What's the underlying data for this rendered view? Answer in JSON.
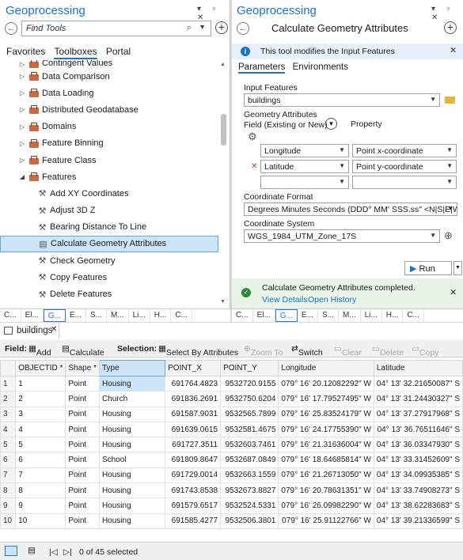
{
  "left": {
    "title": "Geoprocessing",
    "search_placeholder": "Find Tools",
    "tabs": [
      "Favorites",
      "Toolboxes",
      "Portal"
    ],
    "tree": [
      {
        "label": "Contingent Values",
        "level": 1,
        "type": "toolbox",
        "partial": true
      },
      {
        "label": "Data Comparison",
        "level": 1,
        "type": "toolbox"
      },
      {
        "label": "Data Loading",
        "level": 1,
        "type": "toolbox"
      },
      {
        "label": "Distributed Geodatabase",
        "level": 1,
        "type": "toolbox"
      },
      {
        "label": "Domains",
        "level": 1,
        "type": "toolbox"
      },
      {
        "label": "Feature Binning",
        "level": 1,
        "type": "toolbox"
      },
      {
        "label": "Feature Class",
        "level": 1,
        "type": "toolbox"
      },
      {
        "label": "Features",
        "level": 1,
        "type": "toolbox",
        "expanded": true
      },
      {
        "label": "Add XY Coordinates",
        "level": 2,
        "type": "tool"
      },
      {
        "label": "Adjust 3D Z",
        "level": 2,
        "type": "tool"
      },
      {
        "label": "Bearing Distance To Line",
        "level": 2,
        "type": "tool"
      },
      {
        "label": "Calculate Geometry Attributes",
        "level": 2,
        "type": "script",
        "selected": true
      },
      {
        "label": "Check Geometry",
        "level": 2,
        "type": "tool"
      },
      {
        "label": "Copy Features",
        "level": 2,
        "type": "tool"
      },
      {
        "label": "Delete Features",
        "level": 2,
        "type": "tool"
      }
    ],
    "bottom_tabs": [
      "C...",
      "El...",
      "G...",
      "E...",
      "S...",
      "M...",
      "Li...",
      "H...",
      "C..."
    ]
  },
  "right": {
    "title": "Geoprocessing",
    "tool_title": "Calculate Geometry Attributes",
    "info_message": "This tool modifies the Input Features",
    "tabs": [
      "Parameters",
      "Environments"
    ],
    "input_features_label": "Input Features",
    "input_features_value": "buildings",
    "geometry_attributes_label": "Geometry Attributes",
    "field_col_label": "Field (Existing or New)",
    "property_col_label": "Property",
    "rows": [
      {
        "field": "Longitude",
        "property": "Point x-coordinate"
      },
      {
        "field": "Latitude",
        "property": "Point y-coordinate"
      },
      {
        "field": "",
        "property": ""
      }
    ],
    "coord_format_label": "Coordinate Format",
    "coord_format_value": "Degrees Minutes Seconds (DDD° MM' SSS.ss\" <N|S|E|W>)",
    "coord_system_label": "Coordinate System",
    "coord_system_value": "WGS_1984_UTM_Zone_17S",
    "run_label": "Run",
    "success_message": "Calculate Geometry Attributes completed.",
    "view_details": "View Details",
    "open_history": "Open History",
    "bottom_tabs": [
      "C...",
      "El...",
      "G...",
      "E...",
      "S...",
      "M...",
      "Li...",
      "H...",
      "C..."
    ]
  },
  "table": {
    "tab_title": "buildings",
    "toolbar": {
      "field_label": "Field:",
      "add": "Add",
      "calculate": "Calculate",
      "selection_label": "Selection:",
      "select_by_attributes": "Select By Attributes",
      "zoom_to": "Zoom To",
      "switch": "Switch",
      "clear": "Clear",
      "delete": "Delete",
      "copy": "Copy"
    },
    "columns": [
      "OBJECTID *",
      "Shape *",
      "Type",
      "POINT_X",
      "POINT_Y",
      "Longitude",
      "Latitude"
    ],
    "rows": [
      [
        "1",
        "Point",
        "Housing",
        "691764.4823",
        "9532720.9155",
        "079° 16' 20.12082292\" W",
        "04° 13' 32.21650087\" S"
      ],
      [
        "2",
        "Point",
        "Church",
        "691836.2691",
        "9532750.6204",
        "079° 16' 17.79527495\" W",
        "04° 13' 31.24430327\" S"
      ],
      [
        "3",
        "Point",
        "Housing",
        "691587.9031",
        "9532565.7899",
        "079° 16' 25.83524179\" W",
        "04° 13' 37.27917968\" S"
      ],
      [
        "4",
        "Point",
        "Housing",
        "691639.0615",
        "9532581.4675",
        "079° 16' 24.17755390\" W",
        "04° 13' 36.76511646\" S"
      ],
      [
        "5",
        "Point",
        "Housing",
        "691727.3511",
        "9532603.7461",
        "079° 16' 21.31636004\" W",
        "04° 13' 36.03347930\" S"
      ],
      [
        "6",
        "Point",
        "School",
        "691809.8647",
        "9532687.0849",
        "079° 16' 18.64685814\" W",
        "04° 13' 33.31452609\" S"
      ],
      [
        "7",
        "Point",
        "Housing",
        "691729.0014",
        "9532663.1559",
        "079° 16' 21.26713050\" W",
        "04° 13' 34.09935385\" S"
      ],
      [
        "8",
        "Point",
        "Housing",
        "691743.8538",
        "9532673.8827",
        "079° 16' 20.78631351\" W",
        "04° 13' 33.74908273\" S"
      ],
      [
        "9",
        "Point",
        "Housing",
        "691579.6517",
        "9532524.5331",
        "079° 16' 26.09982290\" W",
        "04° 13' 38.62283683\" S"
      ],
      [
        "10",
        "Point",
        "Housing",
        "691585.4277",
        "9532506.3801",
        "079° 16' 25.91122766\" W",
        "04° 13' 39.21336599\" S"
      ]
    ],
    "selection_status": "0 of 45 selected"
  }
}
